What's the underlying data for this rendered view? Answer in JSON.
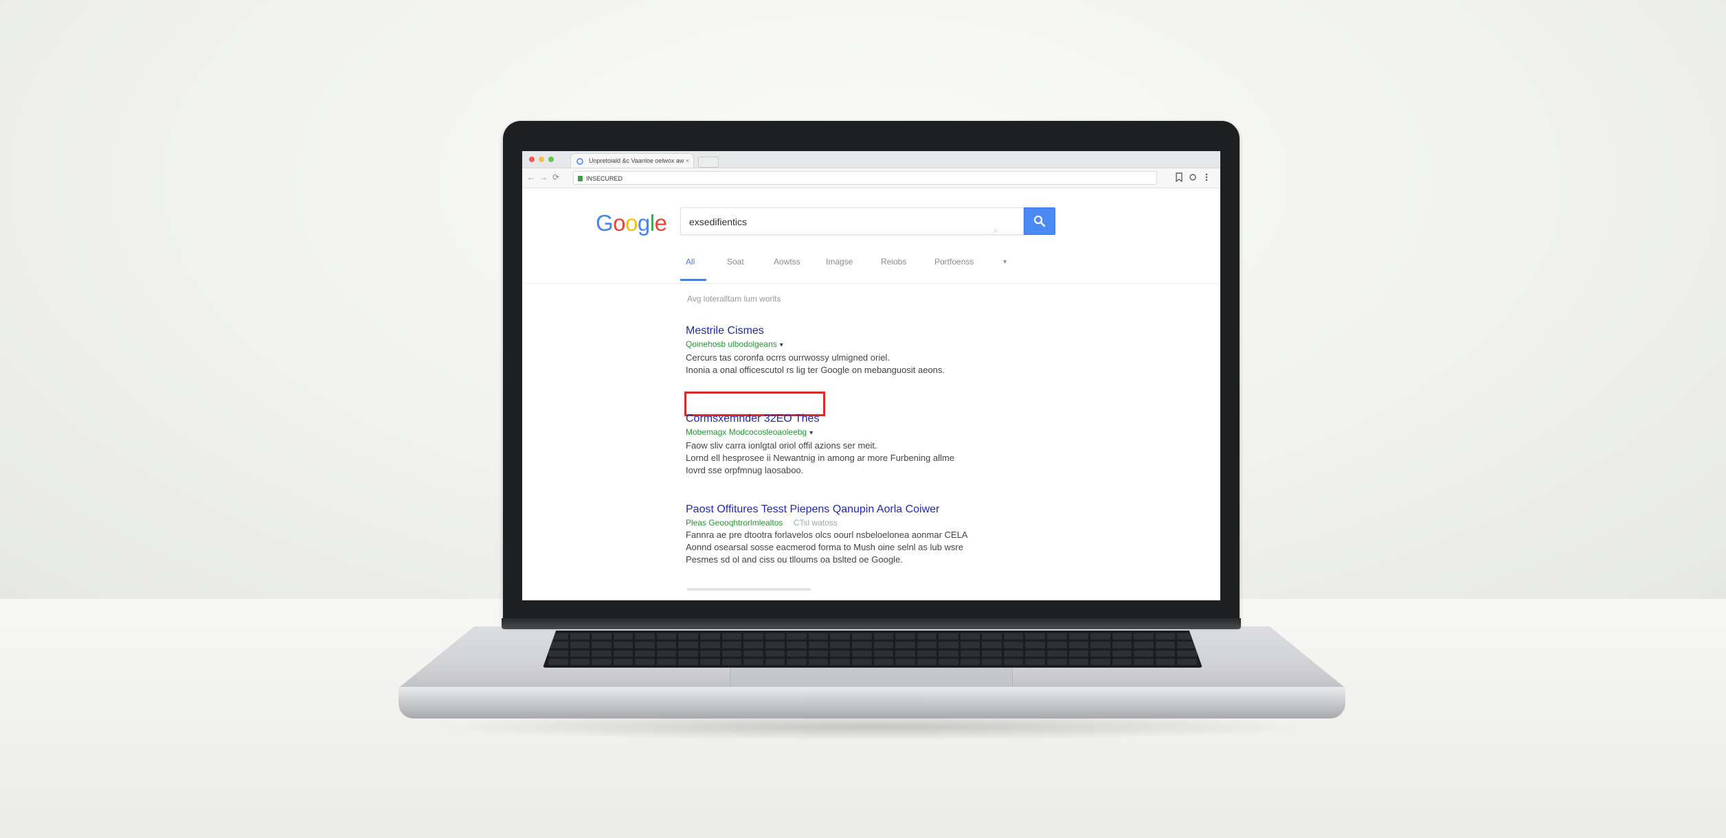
{
  "browser": {
    "tab_title": "Unpretoiald &c Vaanloe oelwox aw",
    "tab_close": "×",
    "address": "INSECURED",
    "back": "←",
    "forward": "→",
    "reload": "⟳",
    "toolbar_icons": [
      "bookmark-icon",
      "extensions-icon",
      "menu-icon"
    ]
  },
  "google": {
    "logo_letters": [
      {
        "ch": "G",
        "color": "#4285f4"
      },
      {
        "ch": "o",
        "color": "#ea4335"
      },
      {
        "ch": "o",
        "color": "#fbbc05"
      },
      {
        "ch": "g",
        "color": "#4285f4"
      },
      {
        "ch": "l",
        "color": "#34a853"
      },
      {
        "ch": "e",
        "color": "#ea4335"
      }
    ],
    "search_query": "exsedifientics",
    "tabs": [
      "All",
      "Soat",
      "Aowtss",
      "Imagse",
      "Reiobs",
      "Portfoenss",
      "▾"
    ],
    "stats": "Avg loteralltam lum worlts",
    "results": [
      {
        "title": "Mestrile Cismes",
        "url": "Qoinehosb ulbodolgeans",
        "snippet": [
          "Cercurs tas coronfa ocrrs ourrwossy ulmigned oriel.",
          "Inonia a onal officescutol rs lig ter Google on mebanguosit aeons."
        ]
      },
      {
        "title": "Cormsxemnder 32EO Thes",
        "url": "Mobemagx Modcocosleoaoleebg",
        "snippet": [
          "Faow sliv carra ionlgtal oriol offil azions ser meit.",
          "Lornd ell hesprosee ii Newantnig in among ar more Furbening allme",
          "Iovrd sse orpfmnug laosaboo."
        ]
      },
      {
        "title": "Paost Offitures Tesst Piepens Qanupin Aorla Coiwer",
        "url": "Pleas Geooqhtrorlmlealtos",
        "url_extra": "CTsl  watoss",
        "snippet": [
          "Fannra ae pre dtootra forlavelos olcs oourl nsbeloelonea aonmar CELA",
          "Aonnd osearsal sosse eacmerod forma to Mush oine selnl as lub wsre",
          "Pesmes sd ol and ciss ou tlloums oa bslted oe Google."
        ]
      }
    ]
  }
}
